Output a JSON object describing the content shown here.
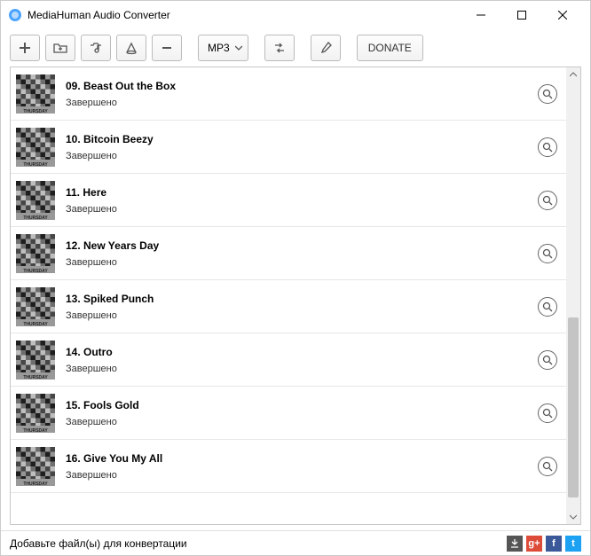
{
  "titlebar": {
    "title": "MediaHuman Audio Converter"
  },
  "toolbar": {
    "format": "MP3",
    "donate": "DONATE"
  },
  "tracks": [
    {
      "title": "09. Beast Out the Box",
      "status": "Завершено"
    },
    {
      "title": "10. Bitcoin Beezy",
      "status": "Завершено"
    },
    {
      "title": "11. Here",
      "status": "Завершено"
    },
    {
      "title": "12. New Years Day",
      "status": "Завершено"
    },
    {
      "title": "13. Spiked Punch",
      "status": "Завершено"
    },
    {
      "title": "14. Outro",
      "status": "Завершено"
    },
    {
      "title": "15. Fools Gold",
      "status": "Завершено"
    },
    {
      "title": "16. Give You My All",
      "status": "Завершено"
    }
  ],
  "statusbar": {
    "message": "Добавьте файл(ы) для конвертации"
  },
  "social": {
    "download": "↓",
    "gplus": "g+",
    "facebook": "f",
    "twitter": "t"
  }
}
